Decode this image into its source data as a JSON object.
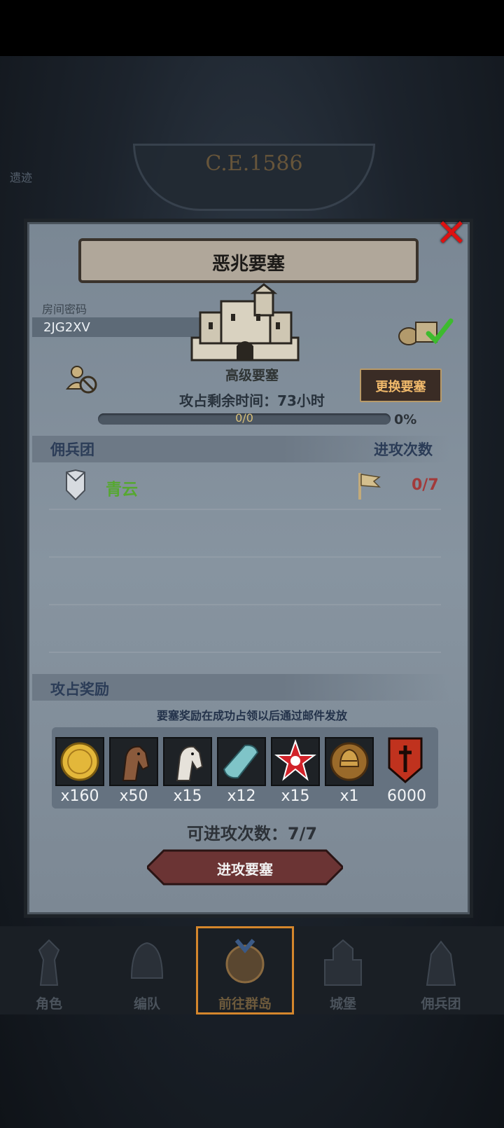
{
  "background": {
    "era": "C.E.1586",
    "side_tag": "遗迹"
  },
  "modal": {
    "title": "恶兆要塞",
    "room_code_label": "房间密码",
    "room_code": "2JG2XV",
    "fortress_grade": "高级要塞",
    "change_button": "更换要塞",
    "time_left": "攻占剩余时间：73小时",
    "progress": {
      "text": "0/0",
      "percent_text": "0%",
      "fraction": 0
    },
    "mercenary_header": "佣兵团",
    "attack_count_header": "进攻次数",
    "mercenary_row": {
      "name": "青云",
      "attacks": "0/7"
    },
    "rewards_header": "攻占奖励",
    "rewards_note": "要塞奖励在成功占领以后通过邮件发放",
    "rewards": [
      {
        "icon": "gold-coin-icon",
        "qty": "x160"
      },
      {
        "icon": "brown-horse-icon",
        "qty": "x50"
      },
      {
        "icon": "white-horse-icon",
        "qty": "x15"
      },
      {
        "icon": "blue-cloth-icon",
        "qty": "x12"
      },
      {
        "icon": "red-star-icon",
        "qty": "x15"
      },
      {
        "icon": "helmet-medal-icon",
        "qty": "x1"
      },
      {
        "icon": "red-banner-icon",
        "qty": "6000"
      }
    ],
    "attacks_remaining": "可进攻次数：7/7",
    "attack_button": "进攻要塞"
  },
  "nav": {
    "items": [
      {
        "label": "角色"
      },
      {
        "label": "编队"
      },
      {
        "label": "前往群岛"
      },
      {
        "label": "城堡"
      },
      {
        "label": "佣兵团"
      }
    ],
    "active_index": 2
  }
}
